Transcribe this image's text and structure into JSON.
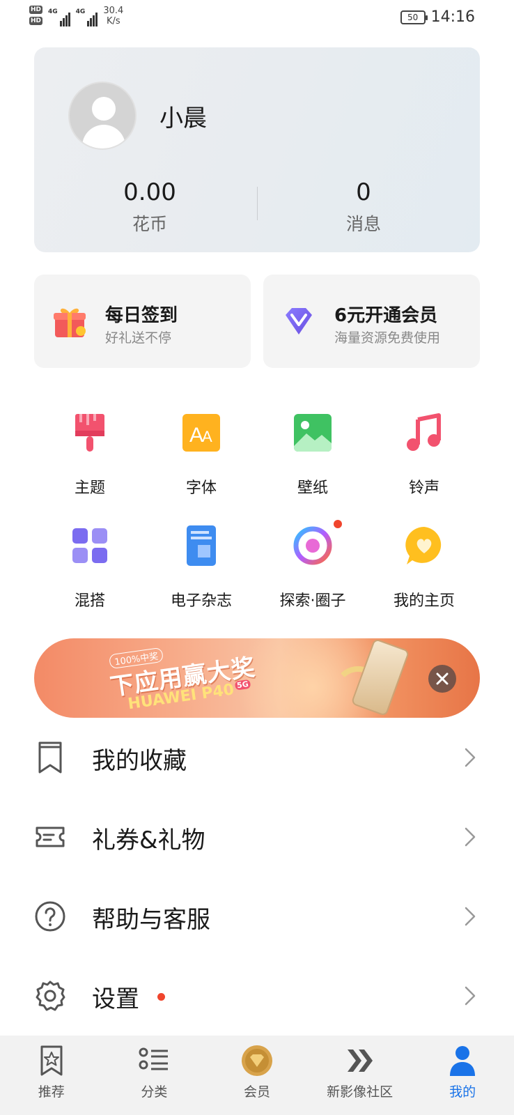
{
  "status_bar": {
    "hd1": "HD",
    "hd2": "HD",
    "net1": "4G",
    "net2": "4G",
    "speed_value": "30.4",
    "speed_unit": "K/s",
    "battery": "50",
    "time": "14:16"
  },
  "profile": {
    "username": "小晨",
    "coins_value": "0.00",
    "coins_label": "花币",
    "messages_value": "0",
    "messages_label": "消息"
  },
  "promos": [
    {
      "title": "每日签到",
      "subtitle": "好礼送不停",
      "icon": "gift-icon"
    },
    {
      "title": "6元开通会员",
      "subtitle": "海量资源免费使用",
      "icon": "vip-diamond-icon"
    }
  ],
  "grid": [
    {
      "label": "主题",
      "icon": "theme-brush-icon"
    },
    {
      "label": "字体",
      "icon": "font-icon"
    },
    {
      "label": "壁纸",
      "icon": "wallpaper-icon"
    },
    {
      "label": "铃声",
      "icon": "ringtone-icon"
    },
    {
      "label": "混搭",
      "icon": "mix-icon"
    },
    {
      "label": "电子杂志",
      "icon": "magazine-icon"
    },
    {
      "label": "探索·圈子",
      "icon": "explore-icon",
      "badge": true
    },
    {
      "label": "我的主页",
      "icon": "homepage-heart-icon"
    }
  ],
  "banner": {
    "tag": "100%中奖",
    "headline": "下应用赢大奖",
    "product": "HUAWEI P40",
    "product_badge": "5G"
  },
  "menu": [
    {
      "label": "我的收藏",
      "icon": "bookmark-icon"
    },
    {
      "label": "礼券&礼物",
      "icon": "coupon-icon"
    },
    {
      "label": "帮助与客服",
      "icon": "help-icon"
    },
    {
      "label": "设置",
      "icon": "settings-gear-icon",
      "badge": true
    }
  ],
  "bottom_nav": [
    {
      "label": "推荐",
      "icon": "recommend-star-icon"
    },
    {
      "label": "分类",
      "icon": "category-list-icon"
    },
    {
      "label": "会员",
      "icon": "member-coin-icon"
    },
    {
      "label": "新影像社区",
      "icon": "community-chevron-icon"
    },
    {
      "label": "我的",
      "icon": "profile-person-icon",
      "active": true
    }
  ],
  "colors": {
    "accent": "#1a73e8",
    "badge_red": "#f0452d",
    "card_bg": "#f4f4f4"
  }
}
